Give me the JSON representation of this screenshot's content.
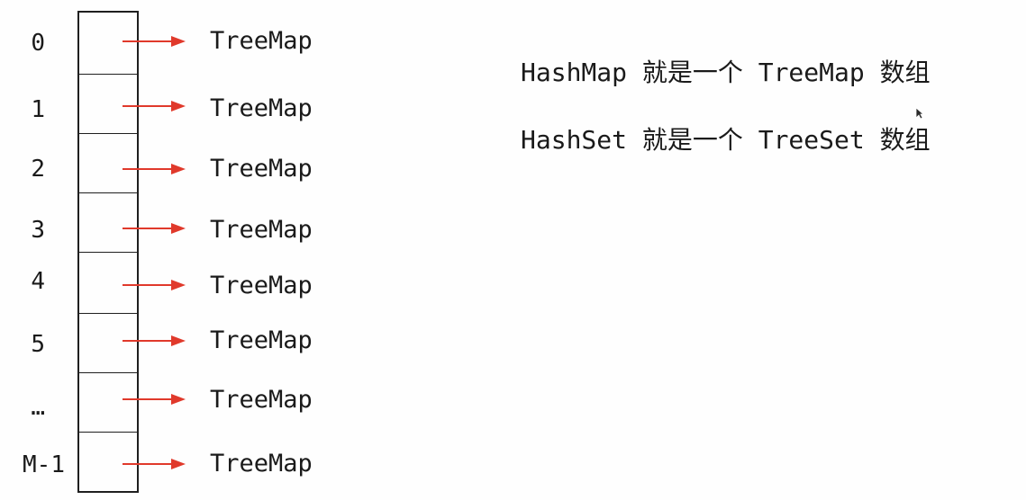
{
  "array": {
    "indices": [
      "0",
      "1",
      "2",
      "3",
      "4",
      "5",
      "…",
      "M-1"
    ],
    "entries": [
      "TreeMap",
      "TreeMap",
      "TreeMap",
      "TreeMap",
      "TreeMap",
      "TreeMap",
      "TreeMap",
      "TreeMap"
    ]
  },
  "notes": [
    "HashMap 就是一个 TreeMap 数组",
    "HashSet 就是一个 TreeSet 数组"
  ],
  "colors": {
    "arrow": "#e0392b",
    "outline": "#1f1f1f",
    "text": "#1a1a1a"
  },
  "icons": {
    "pointer": "arrow-right-icon",
    "cursor": "mouse-cursor-icon"
  }
}
